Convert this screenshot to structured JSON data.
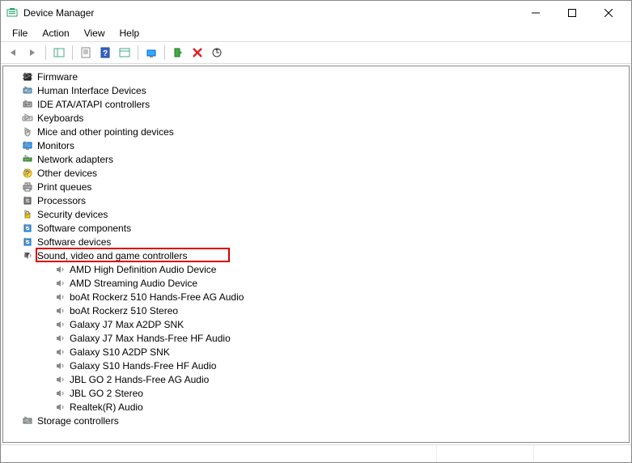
{
  "window": {
    "title": "Device Manager"
  },
  "menu": {
    "file": "File",
    "action": "Action",
    "view": "View",
    "help": "Help"
  },
  "tree": {
    "categories": [
      {
        "label": "Firmware",
        "expanded": false,
        "icon": "chip"
      },
      {
        "label": "Human Interface Devices",
        "expanded": false,
        "icon": "hid"
      },
      {
        "label": "IDE ATA/ATAPI controllers",
        "expanded": false,
        "icon": "ide"
      },
      {
        "label": "Keyboards",
        "expanded": false,
        "icon": "keyboard"
      },
      {
        "label": "Mice and other pointing devices",
        "expanded": false,
        "icon": "mouse"
      },
      {
        "label": "Monitors",
        "expanded": false,
        "icon": "monitor"
      },
      {
        "label": "Network adapters",
        "expanded": false,
        "icon": "network"
      },
      {
        "label": "Other devices",
        "expanded": false,
        "icon": "other"
      },
      {
        "label": "Print queues",
        "expanded": false,
        "icon": "printer"
      },
      {
        "label": "Processors",
        "expanded": false,
        "icon": "cpu"
      },
      {
        "label": "Security devices",
        "expanded": false,
        "icon": "security"
      },
      {
        "label": "Software components",
        "expanded": false,
        "icon": "software"
      },
      {
        "label": "Software devices",
        "expanded": false,
        "icon": "software"
      },
      {
        "label": "Sound, video and game controllers",
        "expanded": true,
        "icon": "sound",
        "highlighted": true,
        "children": [
          {
            "label": "AMD High Definition Audio Device"
          },
          {
            "label": "AMD Streaming Audio Device"
          },
          {
            "label": "boAt Rockerz 510 Hands-Free AG Audio"
          },
          {
            "label": "boAt Rockerz 510 Stereo"
          },
          {
            "label": "Galaxy J7 Max A2DP SNK"
          },
          {
            "label": "Galaxy J7 Max Hands-Free HF Audio"
          },
          {
            "label": "Galaxy S10 A2DP SNK"
          },
          {
            "label": "Galaxy S10 Hands-Free HF Audio"
          },
          {
            "label": "JBL GO 2 Hands-Free AG Audio"
          },
          {
            "label": "JBL GO 2 Stereo"
          },
          {
            "label": "Realtek(R) Audio"
          }
        ]
      },
      {
        "label": "Storage controllers",
        "expanded": false,
        "icon": "storage"
      }
    ]
  }
}
